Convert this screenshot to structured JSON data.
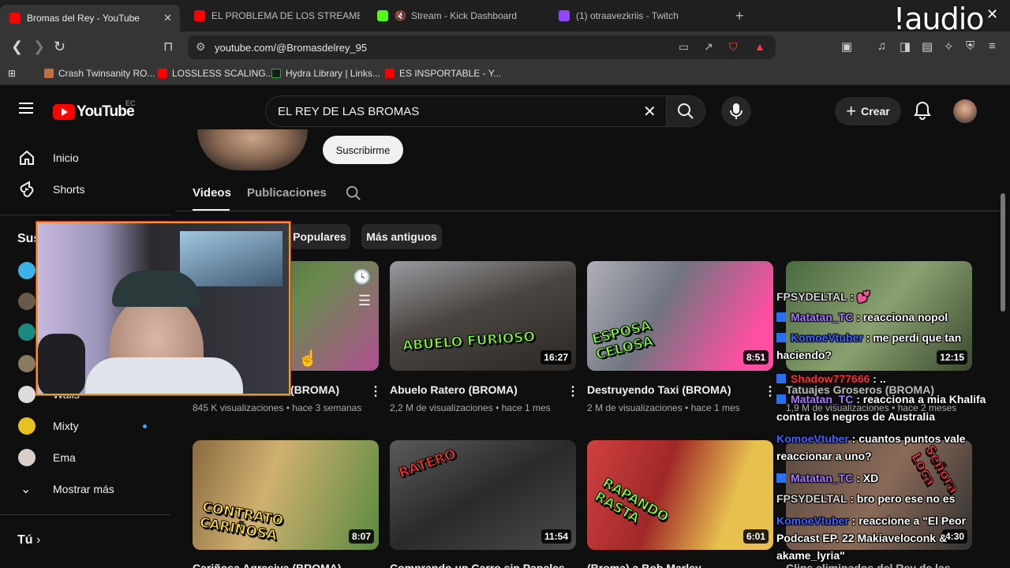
{
  "browser": {
    "tabs": [
      {
        "title": "Bromas del Rey - YouTube",
        "color": "#ff0000"
      },
      {
        "title": "EL PROBLEMA DE LOS STREAMERS E(",
        "color": "#ff0000"
      },
      {
        "title": "Stream - Kick Dashboard",
        "color": "#53fc18"
      },
      {
        "title": "(1) otraavezkriis - Twitch",
        "color": "#9146ff"
      }
    ],
    "url": "youtube.com/@Bromasdelrey_95",
    "bookmarks": [
      "Crash Twinsanity RO...",
      "LOSSLESS SCALING...",
      "Hydra Library | Links...",
      "ES INSPORTABLE - Y..."
    ],
    "overlay_text": "!audio"
  },
  "youtube": {
    "logo": "YouTube",
    "country": "EC",
    "search_value": "EL REY DE LAS BROMAS",
    "create_label": "Crear",
    "sidebar": {
      "home": "Inicio",
      "shorts": "Shorts",
      "subs_heading": "Sus",
      "subscriptions": [
        "Walls",
        "Mixty",
        "Ema"
      ],
      "show_more": "Mostrar más",
      "you": "Tú"
    },
    "subscribe_label": "Suscribirme",
    "channel_tabs": [
      "Videos",
      "Publicaciones"
    ],
    "chips": [
      "Populares",
      "Más antiguos"
    ],
    "videos": [
      {
        "title": "(BROMA)",
        "meta": "845 K visualizaciones • hace 3 semanas",
        "duration": ""
      },
      {
        "title": "Abuelo Ratero (BROMA)",
        "meta": "2,2 M de visualizaciones • hace 1 mes",
        "duration": "16:27",
        "overlay": "ABUELO FURIOSO"
      },
      {
        "title": "Destruyendo Taxi (BROMA)",
        "meta": "2 M de visualizaciones • hace 1 mes",
        "duration": "8:51",
        "overlay": "ESPOSA CELOSA"
      },
      {
        "title": "Tatuajes Groseros (BROMA)",
        "meta": "1,9 M de visualizaciones • hace 2 meses",
        "duration": "12:15"
      },
      {
        "title": "Cariñosa Agresiva (BROMA)",
        "duration": "8:07",
        "overlay": "CONTRATO CARIÑOSA"
      },
      {
        "title": "Comprando un Carro sin Papeles",
        "duration": "11:54",
        "overlay": "RATERO"
      },
      {
        "title": "(Broma) a Bob Marley",
        "duration": "6:01",
        "overlay": "RAPANDO RASTA"
      },
      {
        "title": "Clips eliminados del Rey de las",
        "duration": "4:30",
        "overlay": "Señora Loca"
      }
    ]
  },
  "chat": [
    {
      "user": "FPSYDELTAL",
      "msg": ": 💕",
      "badge": false,
      "cls": "u4"
    },
    {
      "user": "Matatan_TC",
      "msg": ": reacciona nopol",
      "badge": true,
      "cls": "u1"
    },
    {
      "user": "KomoeVtuber",
      "msg": ": me perdi que tan haciendo?",
      "badge": true,
      "cls": "u2"
    },
    {
      "user": "Shadow777666",
      "msg": ": ..",
      "badge": true,
      "cls": "u3"
    },
    {
      "user": "Matatan_TC",
      "msg": ": reacciona a mia Khalifa contra los negros de Australia",
      "badge": true,
      "cls": "u1"
    },
    {
      "user": "KomoeVtuber",
      "msg": ": cuantos puntos vale reaccionar a uno?",
      "badge": false,
      "cls": "u2"
    },
    {
      "user": "Matatan_TC",
      "msg": ": XD",
      "badge": true,
      "cls": "u1"
    },
    {
      "user": "FPSYDELTAL",
      "msg": ": bro pero ese no es",
      "badge": false,
      "cls": "u4"
    },
    {
      "user": "KomoeVtuber",
      "msg": ": reaccione a \"El Peor Podcast EP. 22 Makiaveloconk & akame_lyria\"",
      "badge": false,
      "cls": "u2"
    }
  ]
}
